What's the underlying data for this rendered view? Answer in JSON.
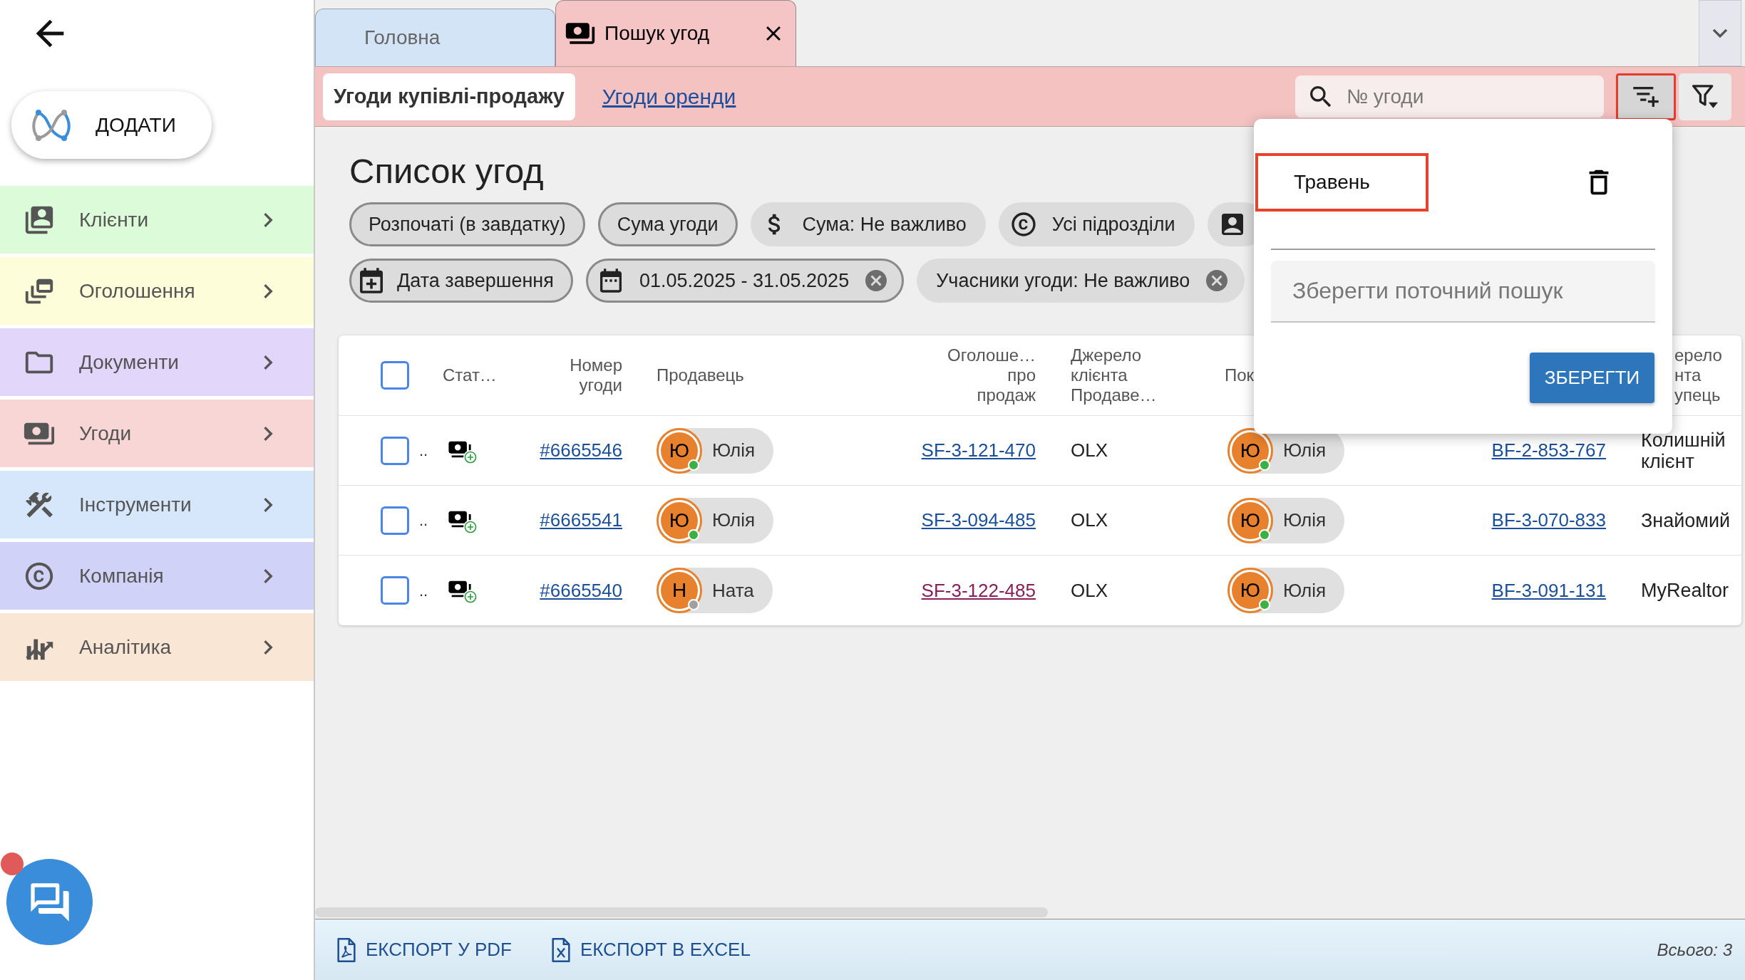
{
  "sidebar": {
    "add_button": "ДОДАТИ",
    "items": [
      {
        "kind": "clients",
        "label": "Клієнти",
        "color": "#dcfbd9"
      },
      {
        "kind": "listings",
        "label": "Оголошення",
        "color": "#fdfdd9"
      },
      {
        "kind": "documents",
        "label": "Документи",
        "color": "#e3d6fb"
      },
      {
        "kind": "deals",
        "label": "Угоди",
        "color": "#f8d6d6"
      },
      {
        "kind": "tools",
        "label": "Інструменти",
        "color": "#d6e7fb"
      },
      {
        "kind": "company",
        "label": "Компанія",
        "color": "#d1d2f7"
      },
      {
        "kind": "analytics",
        "label": "Аналітика",
        "color": "#fae6d4"
      }
    ]
  },
  "tabs": [
    {
      "kind": "home",
      "label": "Головна",
      "selected": false
    },
    {
      "kind": "deals",
      "label": "Пошук угод",
      "selected": true
    }
  ],
  "toolbar": {
    "deal_types": [
      {
        "label": "Угоди купівлі-продажу",
        "selected": true
      },
      {
        "label": "Угоди оренди",
        "selected": false
      }
    ],
    "search": {
      "placeholder": "№ угоди"
    },
    "buttons": [
      {
        "kind": "add-filter",
        "highlighted": true
      },
      {
        "kind": "filter",
        "highlighted": false
      }
    ]
  },
  "page_title": "Список угод",
  "filter_rows": [
    {
      "chips": [
        {
          "kind": "status",
          "label": "Розпочаті (в завдатку)",
          "active": true,
          "clearable": false
        },
        {
          "kind": "sort",
          "label": "Сума угоди",
          "active": true,
          "clearable": false
        },
        {
          "kind": "amount",
          "label": "Сума: Не важливо",
          "active": false,
          "clearable": false
        },
        {
          "kind": "division",
          "label": "Усі підрозділи",
          "active": false,
          "clearable": false
        },
        {
          "kind": "person",
          "active": false,
          "clearable": false
        }
      ]
    },
    {
      "chips": [
        {
          "kind": "end-date",
          "label": "Дата завершення",
          "active": true,
          "clearable": false
        },
        {
          "kind": "date-range",
          "label": "01.05.2025 - 31.05.2025",
          "active": true,
          "clearable": true
        },
        {
          "kind": "participants",
          "label": "Учасники угоди: Не важливо",
          "active": false,
          "clearable": true
        }
      ]
    }
  ],
  "table": {
    "header_checked": false,
    "columns": [
      "Стат…",
      "Номер угоди",
      "Продавець",
      "Оголоше… про продаж",
      "Джерело клієнта Продаве…",
      "Пок",
      "ерело нта упець"
    ],
    "rows": [
      {
        "checked": false,
        "marker": "..",
        "number": "#6665546",
        "seller": {
          "initial": "Ю",
          "name": "Юлія",
          "online": true
        },
        "listing": {
          "code": "SF-3-121-470",
          "visited": false
        },
        "source": "OLX",
        "buyer": {
          "initial": "Ю",
          "name": "Юлія",
          "online": true
        },
        "buyer_listing": {
          "code": "BF-2-853-767",
          "visited": false
        },
        "buyer_source": "Колишній клієнт"
      },
      {
        "checked": false,
        "marker": "..",
        "number": "#6665541",
        "seller": {
          "initial": "Ю",
          "name": "Юлія",
          "online": true
        },
        "listing": {
          "code": "SF-3-094-485",
          "visited": false
        },
        "source": "OLX",
        "buyer": {
          "initial": "Ю",
          "name": "Юлія",
          "online": true
        },
        "buyer_listing": {
          "code": "BF-3-070-833",
          "visited": false
        },
        "buyer_source": "Знайомий"
      },
      {
        "checked": false,
        "marker": "..",
        "number": "#6665540",
        "seller": {
          "initial": "Н",
          "name": "Ната",
          "online": false
        },
        "listing": {
          "code": "SF-3-122-485",
          "visited": true
        },
        "source": "OLX",
        "buyer": {
          "initial": "Ю",
          "name": "Юлія",
          "online": true
        },
        "buyer_listing": {
          "code": "BF-3-091-131",
          "visited": false
        },
        "buyer_source": "MyRealtor"
      }
    ]
  },
  "save_popup": {
    "saved_searches": [
      {
        "label": "Травень",
        "highlighted": true
      }
    ],
    "name_field": {
      "placeholder": "Зберегти поточний пошук"
    },
    "save_button": "ЗБЕРЕГТИ"
  },
  "footer": {
    "exports": [
      {
        "kind": "pdf",
        "label": "ЕКСПОРТ У PDF"
      },
      {
        "kind": "excel",
        "label": "ЕКСПОРТ В EXCEL"
      }
    ],
    "total": "Всього: 3"
  }
}
